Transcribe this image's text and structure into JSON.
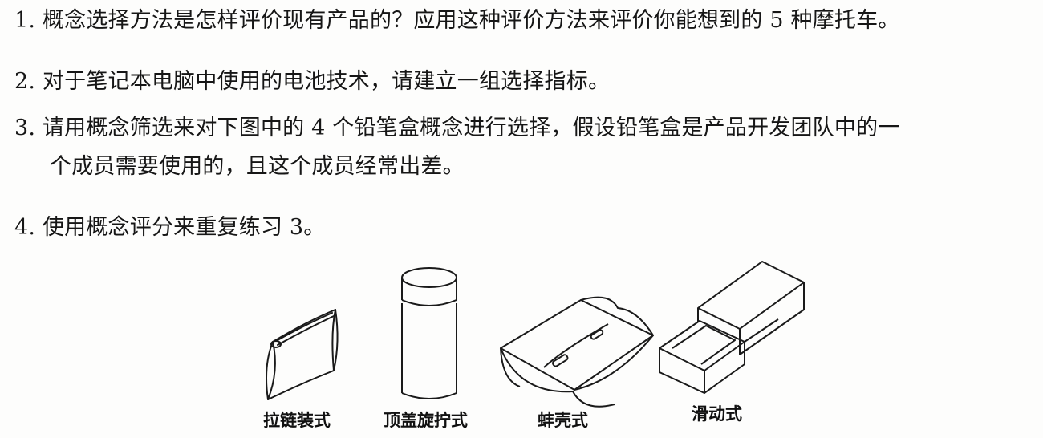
{
  "questions": {
    "q1": "1. 概念选择方法是怎样评价现有产品的？应用这种评价方法来评价你能想到的 5 种摩托车。",
    "q2": "2. 对于笔记本电脑中使用的电池技术，请建立一组选择指标。",
    "q3_line1": "3. 请用概念筛选来对下图中的 4 个铅笔盒概念进行选择，假设铅笔盒是产品开发团队中的一",
    "q3_line2": "个成员需要使用的，且这个成员经常出差。",
    "q4": "4. 使用概念评分来重复练习 3。"
  },
  "figures": {
    "zipper": {
      "label": "拉链装式",
      "icon": "zipper-pouch-icon"
    },
    "screw_cap": {
      "label": "顶盖旋拧式",
      "icon": "screw-cap-tube-icon"
    },
    "clamshell": {
      "label": "蚌壳式",
      "icon": "clamshell-case-icon"
    },
    "sliding": {
      "label": "滑动式",
      "icon": "sliding-box-icon"
    }
  }
}
